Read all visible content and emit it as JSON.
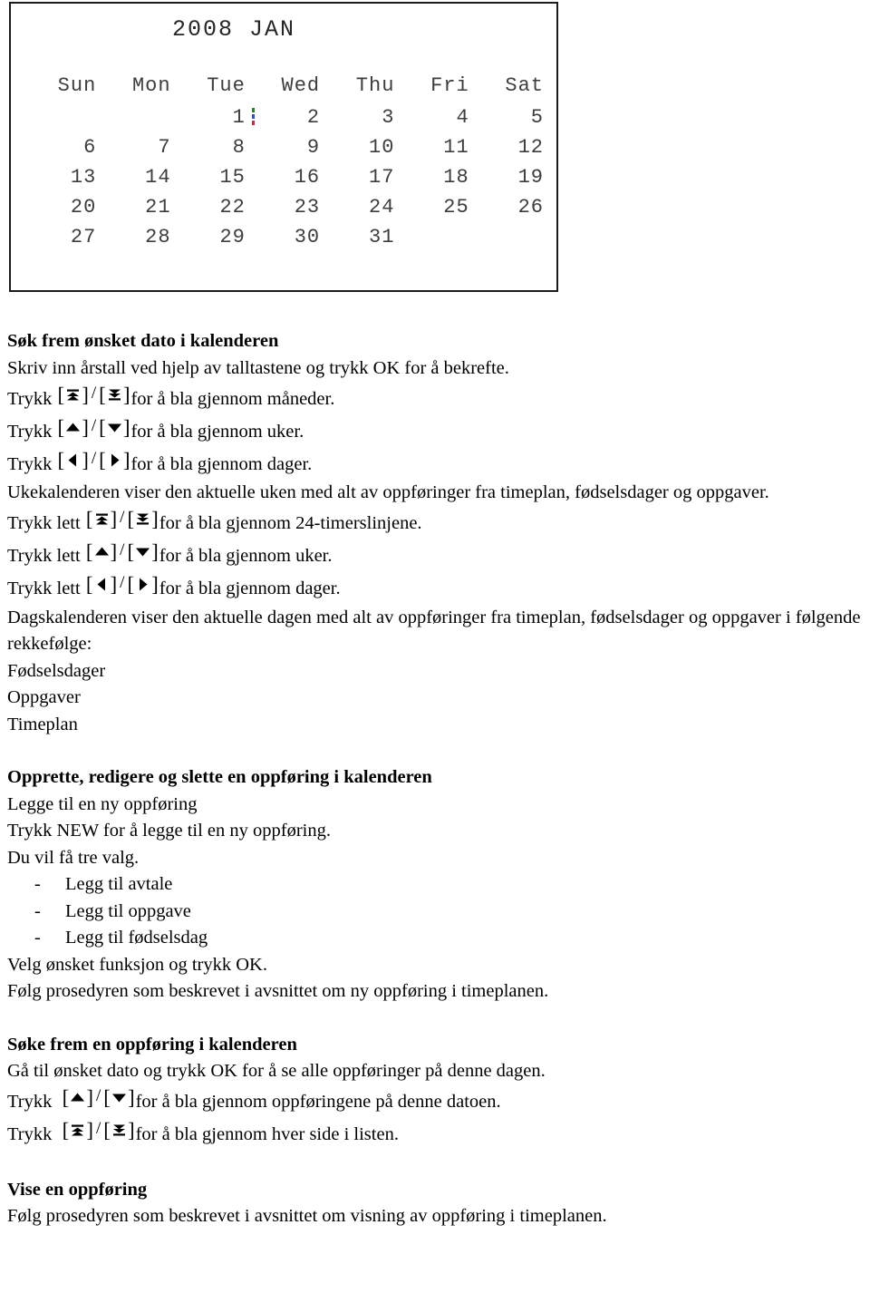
{
  "calendar": {
    "title": "2008  JAN",
    "year": "2008",
    "month": "JAN",
    "weekdays": [
      "Sun",
      "Mon",
      "Tue",
      "Wed",
      "Thu",
      "Fri",
      "Sat"
    ],
    "weeks": [
      [
        "",
        "",
        "1",
        "2",
        "3",
        "4",
        "5"
      ],
      [
        "6",
        "7",
        "8",
        "9",
        "10",
        "11",
        "12"
      ],
      [
        "13",
        "14",
        "15",
        "16",
        "17",
        "18",
        "19"
      ],
      [
        "20",
        "21",
        "22",
        "23",
        "24",
        "25",
        "26"
      ],
      [
        "27",
        "28",
        "29",
        "30",
        "31",
        "",
        ""
      ]
    ],
    "selected_day": "1",
    "cursor_colors": [
      "#2f7d32",
      "#3b4fb5",
      "#b5364a"
    ]
  },
  "sections": {
    "s1": {
      "heading": "Søk frem ønsket dato i kalenderen",
      "intro": "Skriv inn årstall ved hjelp av talltastene og trykk OK for å bekrefte.",
      "rows": [
        {
          "pre": "Trykk ",
          "icons": "page-up-down",
          "post": "for å bla gjennom måneder."
        },
        {
          "pre": "Trykk ",
          "icons": "up-down",
          "post": "for å bla gjennom uker."
        },
        {
          "pre": "Trykk ",
          "icons": "left-right",
          "post": "for å bla gjennom dager."
        }
      ]
    },
    "s2": {
      "para": "Ukekalenderen viser den aktuelle uken med alt av oppføringer fra timeplan, fødselsdager og oppgaver.",
      "rows": [
        {
          "pre": "Trykk lett ",
          "icons": "page-up-down",
          "post": "for å bla gjennom 24-timerslinjene."
        },
        {
          "pre": "Trykk lett ",
          "icons": "up-down",
          "post": "for å bla gjennom uker."
        },
        {
          "pre": "Trykk lett ",
          "icons": "left-right",
          "post": "for å bla gjennom dager."
        }
      ]
    },
    "s3": {
      "para": "Dagskalenderen viser den aktuelle dagen med alt av oppføringer fra timeplan, fødselsdager og oppgaver i følgende rekkefølge:",
      "items": [
        "Fødselsdager",
        "Oppgaver",
        "Timeplan"
      ]
    },
    "s4": {
      "heading": "Opprette, redigere og slette en oppføring i kalenderen",
      "subheading": "Legge til en ny oppføring",
      "line1": "Trykk NEW for å legge til en ny oppføring.",
      "line2": "Du vil få tre valg.",
      "dash": "-",
      "bullets": [
        "Legg til avtale",
        "Legg til oppgave",
        "Legg til fødselsdag"
      ],
      "line3": "Velg ønsket funksjon og trykk OK.",
      "line4": "Følg prosedyren som beskrevet i avsnittet om ny oppføring i timeplanen."
    },
    "s5": {
      "heading": "Søke frem en oppføring i kalenderen",
      "line1": "Gå til ønsket dato og trykk OK for å se alle oppføringer på denne dagen.",
      "rows": [
        {
          "pre": "Trykk  ",
          "icons": "up-down",
          "post": "for å bla gjennom oppføringene på denne datoen."
        },
        {
          "pre": "Trykk  ",
          "icons": "page-up-down",
          "post": "for å bla gjennom hver side i listen."
        }
      ]
    },
    "s6": {
      "heading": "Vise en oppføring",
      "line1": "Følg prosedyren som beskrevet i avsnittet om visning av oppføring i timeplanen."
    }
  },
  "icons": {
    "page-up-icon": "page-up-arrow",
    "page-down-icon": "page-down-arrow",
    "up-icon": "up-arrow",
    "down-icon": "down-arrow",
    "left-icon": "left-arrow",
    "right-icon": "right-arrow",
    "bracket_open": "[",
    "bracket_close": "]",
    "separator": "/"
  }
}
